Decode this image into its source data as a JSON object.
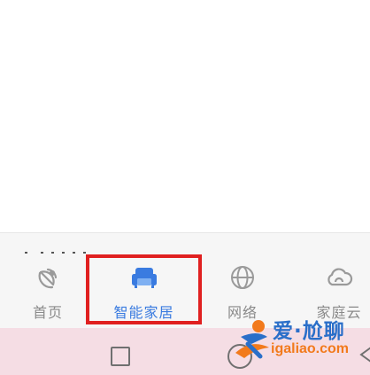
{
  "tabbar": {
    "tabs": [
      {
        "label": "首页",
        "icon": "home-satellite-icon"
      },
      {
        "label": "智能家居",
        "icon": "sofa-icon",
        "active": true
      },
      {
        "label": "网络",
        "icon": "globe-icon"
      },
      {
        "label": "家庭云",
        "icon": "cloud-icon"
      }
    ],
    "active_color": "#3a7be0",
    "inactive_color": "#8a8a8a"
  },
  "highlight": {
    "color": "#e02020"
  },
  "watermark": {
    "title": "爱·尬聊",
    "url": "igaliao.com"
  },
  "navbar": {
    "buttons": [
      "recent-apps-icon",
      "home-circle-icon",
      "back-icon"
    ]
  }
}
